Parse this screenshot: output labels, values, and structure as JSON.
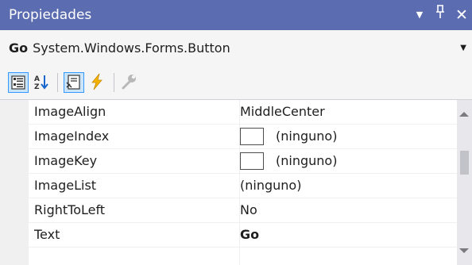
{
  "window": {
    "title": "Propiedades",
    "dropdown_glyph": "▼",
    "pin_glyph": "ᛘ",
    "close_glyph": "✕"
  },
  "object_selector": {
    "name": "Go",
    "type": "System.Windows.Forms.Button",
    "arrow_glyph": "▼"
  },
  "toolbar": {
    "buttons": [
      {
        "icon": "categorized-icon",
        "active": true
      },
      {
        "icon": "alphabetical-icon",
        "active": false
      },
      {
        "icon": "properties-icon",
        "active": true
      },
      {
        "icon": "events-icon",
        "active": false
      },
      {
        "icon": "property-pages-icon",
        "active": false
      }
    ],
    "colors": {
      "lightning": "#f5b400",
      "active_border": "#3399ff",
      "active_bg": "#cce4f7"
    }
  },
  "properties": [
    {
      "name": "ImageAlign",
      "value": "MiddleCenter"
    },
    {
      "name": "ImageIndex",
      "value": "(ninguno)",
      "swatch": true
    },
    {
      "name": "ImageKey",
      "value": "(ninguno)",
      "swatch": true
    },
    {
      "name": "ImageList",
      "value": "(ninguno)"
    },
    {
      "name": "RightToLeft",
      "value": "No"
    },
    {
      "name": "Text",
      "value": "Go",
      "bold": true
    }
  ],
  "colors": {
    "title_bar": "#5b6db0",
    "background": "#f5f5f5",
    "grid_cell": "#ffffff"
  }
}
